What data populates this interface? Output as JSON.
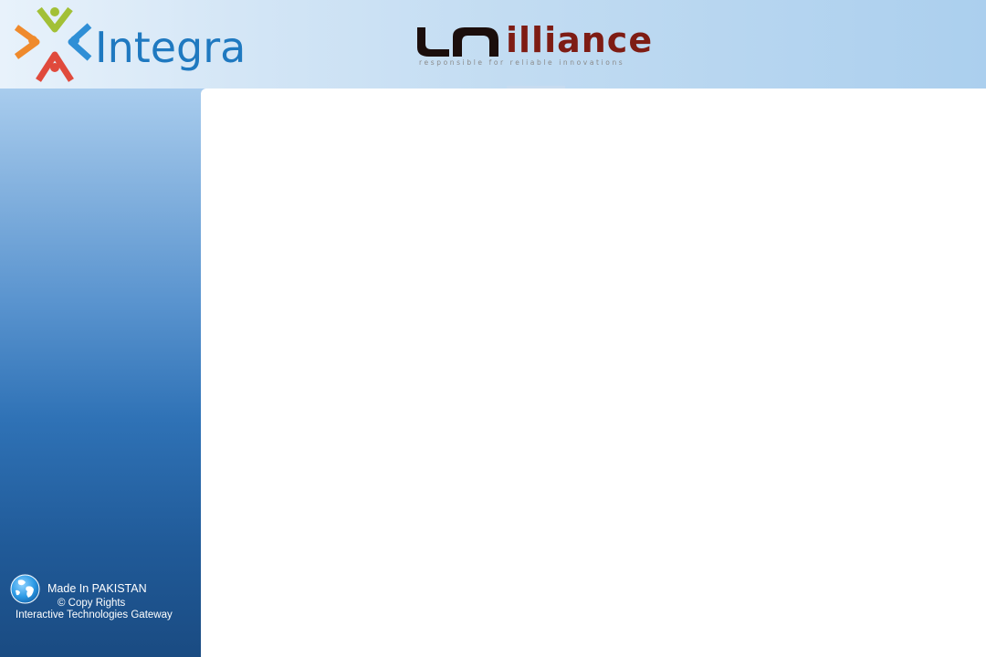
{
  "header": {
    "integra_logo": {
      "name": "Integra",
      "colors": {
        "wordmark": "#1f79c0",
        "figure_green": "#a2c036",
        "figure_blue": "#2f8fd6",
        "figure_orange": "#ef8a2c",
        "figure_red": "#e04a3c"
      }
    },
    "unilliance_logo": {
      "name": "illiance",
      "tagline": "responsible for reliable innovations",
      "colors": {
        "mark": "#1b0e0c",
        "wordmark": "#7e1c14"
      }
    }
  },
  "footer": {
    "made_in": "Made In PAKISTAN",
    "copy_rights": "© Copy Rights",
    "company": "Interactive Technologies Gateway",
    "icon": "globe-icon"
  }
}
